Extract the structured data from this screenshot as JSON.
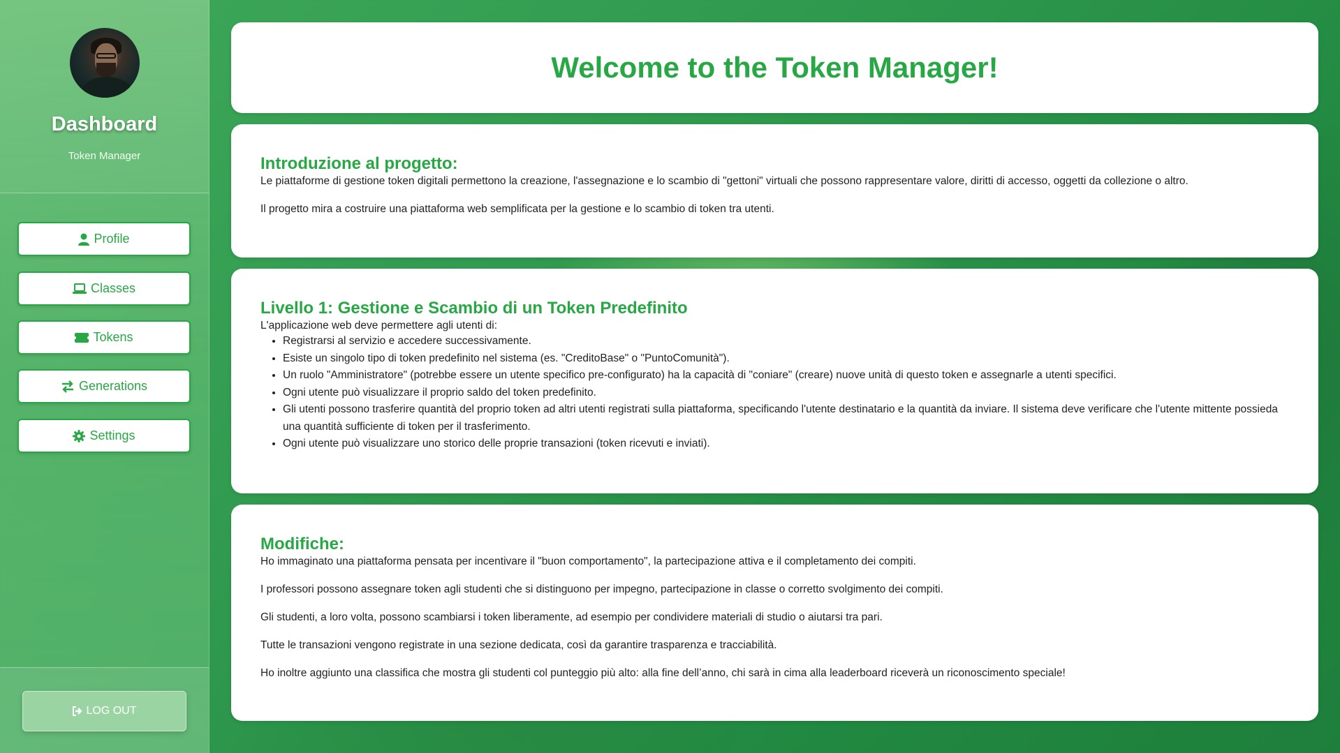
{
  "sidebar": {
    "title": "Dashboard",
    "subtitle": "Token Manager",
    "nav": [
      {
        "label": "Profile",
        "icon": "user-icon"
      },
      {
        "label": "Classes",
        "icon": "laptop-icon"
      },
      {
        "label": "Tokens",
        "icon": "ticket-icon"
      },
      {
        "label": "Generations",
        "icon": "exchange-icon"
      },
      {
        "label": "Settings",
        "icon": "gear-icon"
      }
    ],
    "logout_label": "LOG OUT"
  },
  "welcome": {
    "title": "Welcome to the Token Manager!"
  },
  "intro": {
    "heading": "Introduzione al progetto:",
    "paragraphs": [
      "Le piattaforme di gestione token digitali permettono la creazione, l'assegnazione e lo scambio di \"gettoni\" virtuali che possono rappresentare valore, diritti di accesso, oggetti da collezione o altro.",
      "Il progetto mira a costruire una piattaforma web semplificata per la gestione e lo scambio di token tra utenti."
    ]
  },
  "level1": {
    "heading": "Livello 1: Gestione e Scambio di un Token Predefinito",
    "lead": "L'applicazione web deve permettere agli utenti di:",
    "items": [
      "Registrarsi al servizio e accedere successivamente.",
      "Esiste un singolo tipo di token predefinito nel sistema (es. \"CreditoBase\" o \"PuntoComunità\").",
      "Un ruolo \"Amministratore\" (potrebbe essere un utente specifico pre-configurato) ha la capacità di \"coniare\" (creare) nuove unità di questo token e assegnarle a utenti specifici.",
      "Ogni utente può visualizzare il proprio saldo del token predefinito.",
      "Gli utenti possono trasferire quantità del proprio token ad altri utenti registrati sulla piattaforma, specificando l'utente destinatario e la quantità da inviare. Il sistema deve verificare che l'utente mittente possieda una quantità sufficiente di token per il trasferimento.",
      "Ogni utente può visualizzare uno storico delle proprie transazioni (token ricevuti e inviati)."
    ]
  },
  "changes": {
    "heading": "Modifiche:",
    "paragraphs": [
      "Ho immaginato una piattaforma pensata per incentivare il \"buon comportamento\", la partecipazione attiva e il completamento dei compiti.",
      "I professori possono assegnare token agli studenti che si distinguono per impegno, partecipazione in classe o corretto svolgimento dei compiti.",
      "Gli studenti, a loro volta, possono scambiarsi i token liberamente, ad esempio per condividere materiali di studio o aiutarsi tra pari.",
      "Tutte le transazioni vengono registrate in una sezione dedicata, così da garantire trasparenza e tracciabilità.",
      "Ho inoltre aggiunto una classifica che mostra gli studenti col punteggio più alto: alla fine dell’anno, chi sarà in cima alla leaderboard riceverà un riconoscimento speciale!"
    ]
  }
}
